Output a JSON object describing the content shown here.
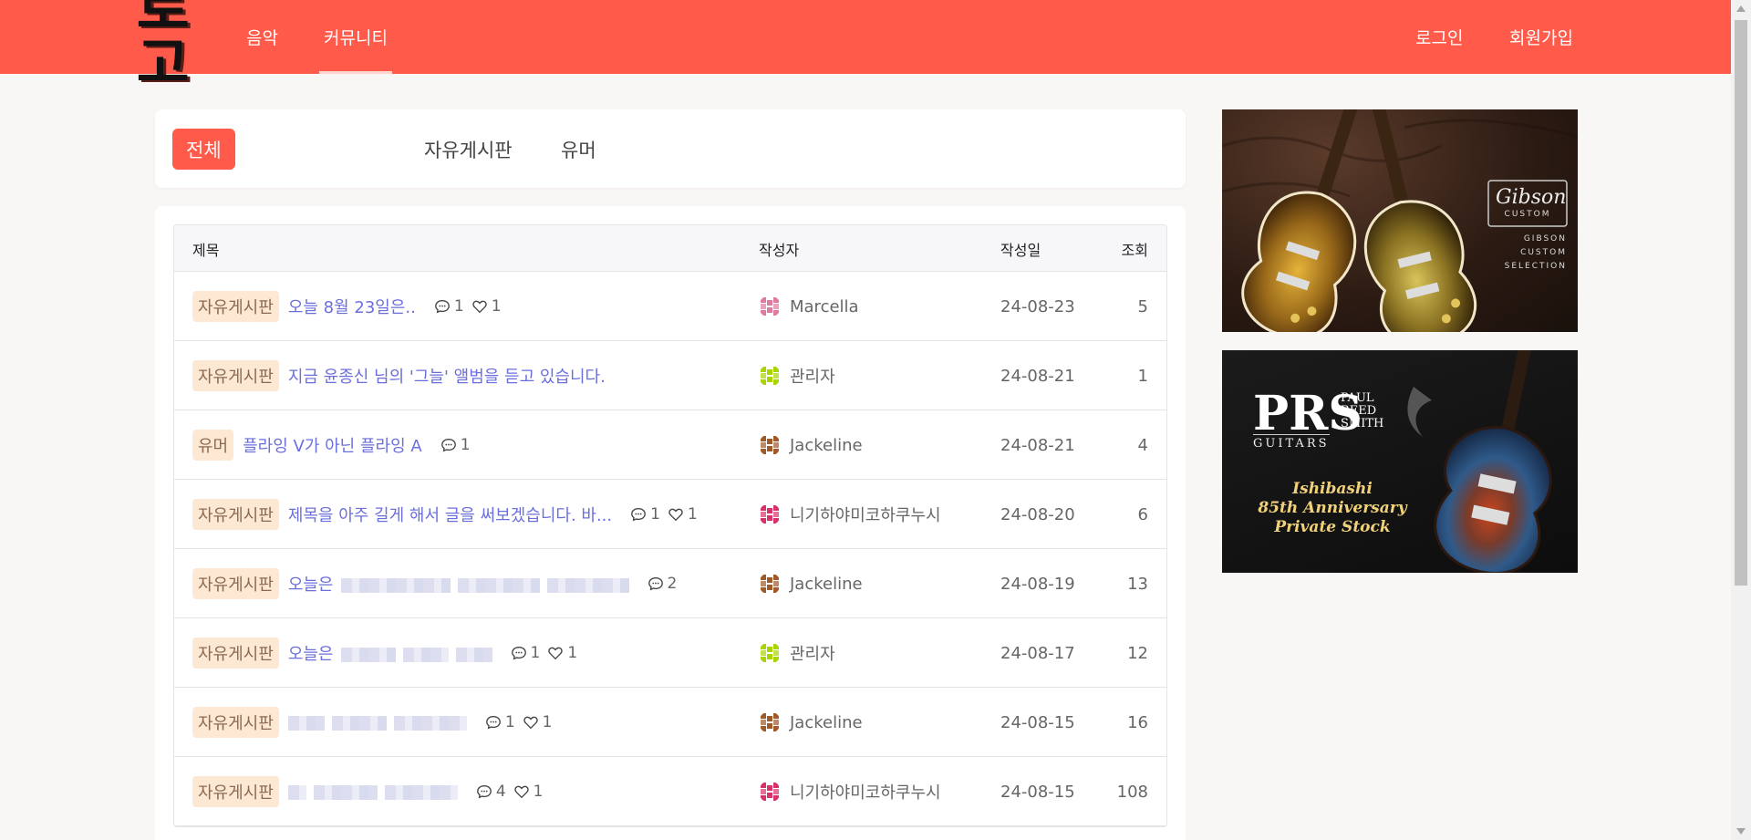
{
  "header": {
    "logo_text": "로고",
    "nav": [
      {
        "label": "음악"
      },
      {
        "label": "커뮤니티",
        "active": true
      }
    ],
    "login_label": "로그인",
    "signup_label": "회원가입"
  },
  "tabs": [
    {
      "label": "전체",
      "active": true
    },
    {
      "label": "자유게시판"
    },
    {
      "label": "유머"
    }
  ],
  "table": {
    "headers": {
      "title": "제목",
      "author": "작성자",
      "date": "작성일",
      "views": "조회"
    },
    "rows": [
      {
        "category": "자유게시판",
        "title": "오늘 8월 23일은..",
        "comments": "1",
        "likes": "1",
        "author": "Marcella",
        "date": "24-08-23",
        "views": "5"
      },
      {
        "category": "자유게시판",
        "title": "지금 윤종신 님의 '그늘' 앨범을 듣고 있습니다.",
        "author": "관리자",
        "date": "24-08-21",
        "views": "1"
      },
      {
        "category": "유머",
        "title": "플라잉 V가 아닌 플라잉 A",
        "comments": "1",
        "author": "Jackeline",
        "date": "24-08-21",
        "views": "4"
      },
      {
        "category": "자유게시판",
        "title": "제목을 아주 길게 해서 글을 써보겠습니다. 바...",
        "comments": "1",
        "likes": "1",
        "author": "니기하야미코하쿠누시",
        "date": "24-08-20",
        "views": "6"
      },
      {
        "category": "자유게시판",
        "title": "오늘은",
        "comments": "2",
        "author": "Jackeline",
        "date": "24-08-19",
        "views": "13"
      },
      {
        "category": "자유게시판",
        "title": "오늘은",
        "comments": "1",
        "likes": "1",
        "author": "관리자",
        "date": "24-08-17",
        "views": "12"
      },
      {
        "category": "자유게시판",
        "title": "",
        "comments": "1",
        "likes": "1",
        "author": "Jackeline",
        "date": "24-08-15",
        "views": "16"
      },
      {
        "category": "자유게시판",
        "title": "",
        "comments": "4",
        "likes": "1",
        "author": "니기하야미코하쿠누시",
        "date": "24-08-15",
        "views": "108"
      }
    ]
  },
  "ads": {
    "gibson": {
      "brand": "Gibson",
      "sub": "CUSTOM",
      "lines": [
        "GIBSON",
        "CUSTOM",
        "SELECTION"
      ]
    },
    "prs": {
      "logo": "PRS",
      "name_lines": [
        "PAUL",
        "REED",
        "SMITH"
      ],
      "guitars": "GUITARS",
      "tagline": [
        "Ishibashi",
        "85th Anniversary",
        "Private Stock"
      ]
    }
  },
  "colors": {
    "accent": "#ff5a4a",
    "badge_bg": "#fde8d3",
    "title_link": "#6b6fdc"
  }
}
